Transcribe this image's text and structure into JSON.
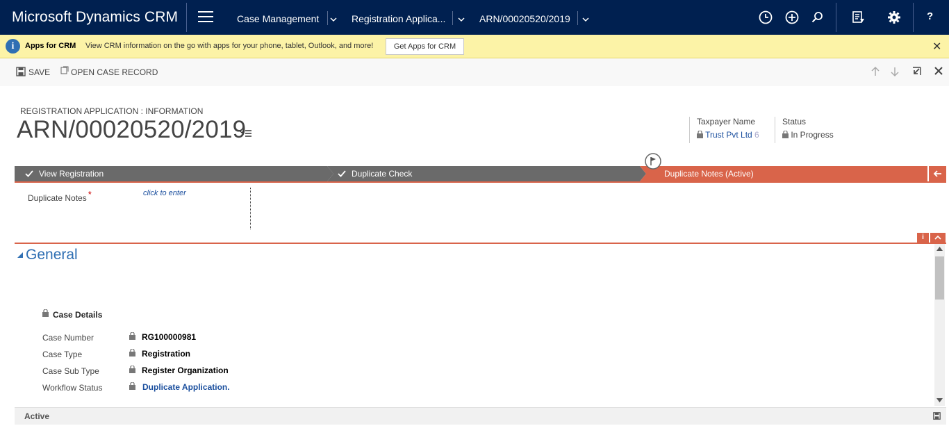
{
  "nav": {
    "brand": "Microsoft Dynamics CRM",
    "crumbs": [
      "Case Management",
      "Registration Applica...",
      "ARN/00020520/2019"
    ],
    "help": "?"
  },
  "notify": {
    "title": "Apps for CRM",
    "message": "View CRM information on the go with apps for your phone, tablet, Outlook, and more!",
    "button": "Get Apps for CRM",
    "close": "✕"
  },
  "command": {
    "save": "SAVE",
    "open_case": "OPEN CASE RECORD"
  },
  "header": {
    "entity_form": "REGISTRATION APPLICATION : INFORMATION",
    "title": "ARN/00020520/2019",
    "fields": [
      {
        "label": "Taxpayer Name",
        "value": "Trust Pvt Ltd",
        "suffix": "6"
      },
      {
        "label": "Status",
        "value": "In Progress"
      }
    ]
  },
  "process": {
    "stages": [
      "View Registration",
      "Duplicate Check",
      "Duplicate Notes (Active)"
    ],
    "field_label": "Duplicate Notes",
    "required_mark": "*",
    "field_placeholder": "click to enter"
  },
  "general": {
    "title": "General",
    "section": "Case Details",
    "fields": [
      {
        "label": "Case Number",
        "value": "RG100000981"
      },
      {
        "label": "Case Type",
        "value": "Registration"
      },
      {
        "label": "Case Sub Type",
        "value": "Register Organization"
      },
      {
        "label": "Workflow Status",
        "value": "Duplicate Application."
      }
    ]
  },
  "status_bar": {
    "state": "Active"
  },
  "colors": {
    "nav": "#002050",
    "active_stage": "#d9644a",
    "stage": "#6a6a6a",
    "link": "#1b4f9e"
  }
}
